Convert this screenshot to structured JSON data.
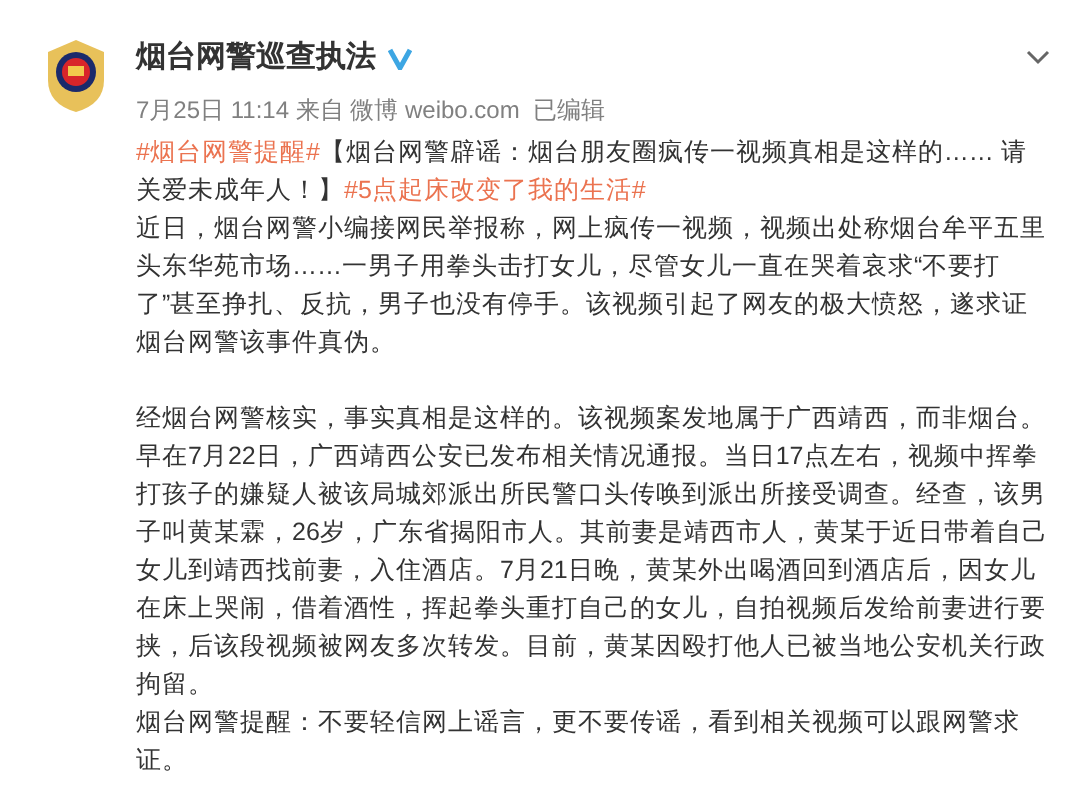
{
  "post": {
    "author": "烟台网警巡查执法",
    "verified": true,
    "meta": "7月25日 11:14 来自 微博 weibo.com  已编辑",
    "sections": [
      {
        "paragraphs": [
          {
            "segments": [
              {
                "kind": "hashtag",
                "text": "#烟台网警提醒#"
              },
              {
                "kind": "text",
                "text": "【烟台网警辟谣：烟台朋友圈疯传一视频真相是这样的…… 请关爱未成年人！】"
              },
              {
                "kind": "hashtag",
                "text": "#5点起床改变了我的生活#"
              }
            ]
          },
          {
            "segments": [
              {
                "kind": "text",
                "text": "近日，烟台网警小编接网民举报称，网上疯传一视频，视频出处称烟台牟平五里头东华苑市场……一男子用拳头击打女儿，尽管女儿一直在哭着哀求“不要打了”甚至挣扎、反抗，男子也没有停手。该视频引起了网友的极大愤怒，遂求证烟台网警该事件真伪。"
              }
            ]
          }
        ]
      },
      {
        "paragraphs": [
          {
            "segments": [
              {
                "kind": "text",
                "text": "经烟台网警核实，事实真相是这样的。该视频案发地属于广西靖西，而非烟台。早在7月22日，广西靖西公安已发布相关情况通报。当日17点左右，视频中挥拳打孩子的嫌疑人被该局城郊派出所民警口头传唤到派出所接受调查。经查，该男子叫黄某霖，26岁，广东省揭阳市人。其前妻是靖西市人，黄某于近日带着自己女儿到靖西找前妻，入住酒店。7月21日晚，黄某外出喝酒回到酒店后，因女儿在床上哭闹，借着酒性，挥起拳头重打自己的女儿，自拍视频后发给前妻进行要挟，后该段视频被网友多次转发。目前，黄某因殴打他人已被当地公安机关行政拘留。"
              }
            ]
          },
          {
            "segments": [
              {
                "kind": "text",
                "text": "烟台网警提醒：不要轻信网上谣言，更不要传谣，看到相关视频可以跟网警求证。"
              }
            ]
          }
        ]
      }
    ]
  }
}
